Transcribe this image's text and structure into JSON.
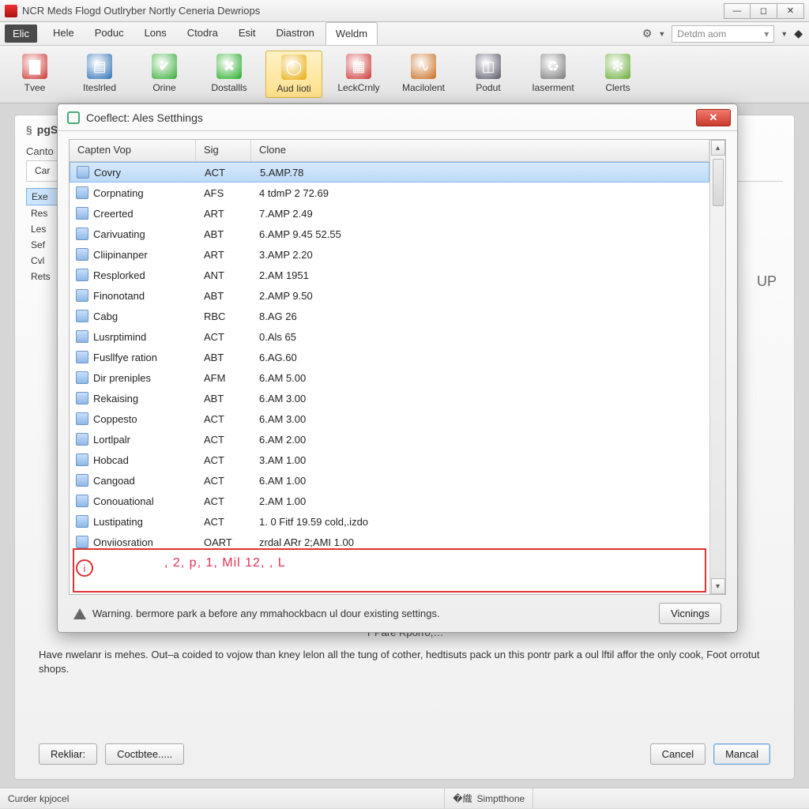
{
  "window": {
    "title": "NCR Meds Flogd Outlryber Nortly Ceneria Dewriops"
  },
  "menubar": {
    "elic": "Elic",
    "items": [
      "Hele",
      "Poduc",
      "Lons",
      "Ctodra",
      "Esit",
      "Diastron",
      "Weldm"
    ],
    "active_index": 6,
    "dropdown_placeholder": "Detdm aom"
  },
  "toolbar": {
    "items": [
      {
        "label": "Tvee",
        "icon": "badge",
        "color": "#c33"
      },
      {
        "label": "Iteslrled",
        "icon": "panel",
        "color": "#2a6fb5"
      },
      {
        "label": "Orine",
        "icon": "check",
        "color": "#3a3"
      },
      {
        "label": "Dostallls",
        "icon": "x",
        "color": "#2a2"
      },
      {
        "label": "Aud Iioti",
        "icon": "chrome",
        "color": "#e6a800"
      },
      {
        "label": "LeckCrnly",
        "icon": "grid",
        "color": "#c33"
      },
      {
        "label": "Macilolent",
        "icon": "wave",
        "color": "#c86a1a"
      },
      {
        "label": "Podut",
        "icon": "meter",
        "color": "#556"
      },
      {
        "label": "Iaserment",
        "icon": "recycle",
        "color": "#777"
      },
      {
        "label": "Clerts",
        "icon": "leaf",
        "color": "#6a3"
      }
    ],
    "selected_index": 4
  },
  "background": {
    "header": "pgS",
    "section_label": "Canto",
    "tabs": [
      "Car"
    ],
    "side_items": [
      "Exe",
      "Res",
      "Les",
      "Sef",
      "Cvl",
      "Rets"
    ],
    "side_selected_index": 0,
    "right_label": "UP",
    "pare_link": "T Pare Rporro,…",
    "paragraph": "Have nwelanr is mehes. Out–a coided to vojow than kney lelon all the tung of cother, hedtisuts pack un this pontr park a oul lftil affor the only cook, Foot orrotut shops.",
    "footer": {
      "left1": "Rekliar:",
      "left2": "Coctbtee.....",
      "cancel": "Cancel",
      "mancal": "Mancal"
    }
  },
  "statusbar": {
    "left": "Curder kpjocel",
    "right": "Simptthone"
  },
  "dialog": {
    "title": "Coeflect: Ales Setthings",
    "columns": [
      "Capten Vop",
      "Sig",
      "Clone"
    ],
    "rows": [
      {
        "name": "Covry",
        "sig": "ACT",
        "clone": "5.AMP.78",
        "selected": true
      },
      {
        "name": "Corpnating",
        "sig": "AFS",
        "clone": "4 tdmP 2 72.69"
      },
      {
        "name": "Creerted",
        "sig": "ART",
        "clone": "7.AMP 2.49"
      },
      {
        "name": "Carivuating",
        "sig": "ABT",
        "clone": "6.AMP 9.45 52.55"
      },
      {
        "name": "Cliipinanper",
        "sig": "ART",
        "clone": "3.AMP 2.20"
      },
      {
        "name": "Resplorked",
        "sig": "ANT",
        "clone": "2.AM 1951"
      },
      {
        "name": "Finonotand",
        "sig": "ABT",
        "clone": "2.AMP 9.50"
      },
      {
        "name": "Cabg",
        "sig": "RBC",
        "clone": "8.AG 26"
      },
      {
        "name": "Lusrptimind",
        "sig": "ACT",
        "clone": "0.Als 65"
      },
      {
        "name": "Fusllfye ration",
        "sig": "ABT",
        "clone": "6.AG.60"
      },
      {
        "name": "Dir preniples",
        "sig": "AFM",
        "clone": "6.AM 5.00"
      },
      {
        "name": "Rekaising",
        "sig": "ABT",
        "clone": "6.AM 3.00"
      },
      {
        "name": "Coppesto",
        "sig": "ACT",
        "clone": "6.AM 3.00"
      },
      {
        "name": "Lortlpalr",
        "sig": "ACT",
        "clone": "6.AM 2.00"
      },
      {
        "name": "Hobcad",
        "sig": "ACT",
        "clone": "3.AM 1.00"
      },
      {
        "name": "Cangoad",
        "sig": "ACT",
        "clone": "6.AM 1.00"
      },
      {
        "name": "Conouational",
        "sig": "ACT",
        "clone": "2.AM 1.00"
      },
      {
        "name": "Lustipating",
        "sig": "ACT",
        "clone": "1. 0 Fitf 19.59 cold,.izdo"
      },
      {
        "name": "Onviiosration",
        "sig": "OART",
        "clone": "zrdal ARr 2;AMI 1.00"
      }
    ],
    "overlay_text": ", 2, p, 1, Mil 12,  , L",
    "warning": "Warning. bermore park a before any mmahockbacn ul dour existing settings.",
    "vicnings": "Vicnings"
  }
}
